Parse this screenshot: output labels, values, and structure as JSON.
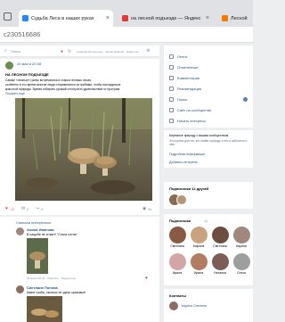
{
  "browser": {
    "tabs": [
      {
        "label": "Судьба Леса в наших руках",
        "color": "#2787f5",
        "active": true
      },
      {
        "label": "на лесной подъезде — Яндекс",
        "color": "#e53935",
        "active": false
      },
      {
        "label": "Лесной",
        "color": "#f57c00",
        "active": false
      }
    ],
    "url": "c230516686"
  },
  "feed": {
    "search_placeholder": "Поиск",
    "filter_text": "Сначала интересные · Кроме записей · Новые записи ·",
    "post": {
      "date": "20 мая в 20:08",
      "title": "НА ЛЕСНОМ ПОДЪЕЗДЕ",
      "text_line1": "Самые «лесные» грибы встречаются в старых еловых лесах,",
      "text_line2": "особенно в это время многие люди отправляются за грибами, чтобы насладиться",
      "text_line3": "красотой природы. Время собирать урожай и получить удовольствие от прогулки.",
      "more": "Показать ещё",
      "likes": "17",
      "comments_count": "2",
      "reposts": "4",
      "views": "91"
    },
    "comments": {
      "header": "Сначала интересные",
      "items": [
        {
          "author": "Алина Иванова",
          "text": "В чащобе не сгнает! \"Сосна сосна\"",
          "time": "20 мая в 20:40 · Ответить · Поделиться"
        },
        {
          "author": "Светлана Попова",
          "text": "Какие грибы, сколько их здесь красивые",
          "time": ""
        }
      ]
    }
  },
  "sidebar": {
    "menu": [
      "Лента",
      "Отмеченные",
      "Комментарии",
      "Рекомендации",
      "Поиск",
      "Сайт на сообществе",
      "Начать интересы"
    ],
    "notify": {
      "title": "Бережное природу с вашим сообществом.",
      "text": "Это группа для тех, кто любит природу и лес и заботится о нём.",
      "link": "Подробная информация"
    },
    "add_link": "Добавить интересы",
    "subscriptions_title": "Подписчики 12 друзей",
    "friends_title": "Подписчики",
    "friends_count": "12",
    "friends": [
      {
        "name": "Светлана",
        "color": "#8a5a44"
      },
      {
        "name": "Марина",
        "color": "#c9a27e"
      },
      {
        "name": "Светлана",
        "color": "#6d4c41"
      },
      {
        "name": "Карина",
        "color": "#a1887f"
      },
      {
        "name": "Ирина",
        "color": "#d4a5a5"
      },
      {
        "name": "Ирина",
        "color": "#b07d62"
      },
      {
        "name": "Наталья",
        "color": "#7b5e57"
      },
      {
        "name": "Ольга",
        "color": "#9e9e9e"
      }
    ],
    "contacts_title": "Контакты",
    "contact_name": "Карина Оленина"
  }
}
